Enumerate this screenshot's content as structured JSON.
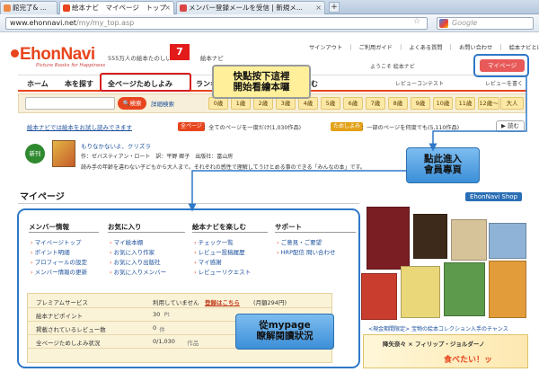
{
  "browser": {
    "tabs": [
      {
        "label": "館完了& ..."
      },
      {
        "label": "絵本ナビ　マイページ　トップ"
      },
      {
        "label": "メンバー登録メールを受信 | 新規メ..."
      }
    ],
    "url_host": "www.ehonnavi.net",
    "url_path": "/my/my_top.asp",
    "search_placeholder": "Google"
  },
  "site": {
    "logo": "EhonNavi",
    "logo_sub": "Picture Books for Happiness",
    "tagline": "555万人の絵本たのしい",
    "tagline_suffix": "絵本ナビ",
    "toplinks": "サインアウト　｜　ご利用ガイド　｜　よくある質問　｜　お問い合わせ　｜　絵本ナビとは",
    "welcome": "ようこそ 絵本ナビ",
    "mypage_button": "マイページ"
  },
  "nav": {
    "home": "ホーム",
    "find": "本を探す",
    "fullpage": "全ページためしよみ",
    "more1": "ランキ",
    "more2": "しむ",
    "review_contest": "レビューコンテスト",
    "review_link": "レビューを書く"
  },
  "search": {
    "button": "検索",
    "advanced": "詳細検索",
    "ages": [
      "0歳",
      "1歳",
      "2歳",
      "3歳",
      "4歳",
      "5歳",
      "6歳",
      "7歳",
      "8歳",
      "9歳",
      "10歳",
      "11歳",
      "12歳～",
      "大人"
    ]
  },
  "info": {
    "link": "絵本ナビでは絵本をお試し読みできます",
    "badge1": "全ページ",
    "text1": "：全てのページを一度だけ(1,030作品)",
    "badge2": "ためしよみ",
    "text2": "：一部のページを何度でも(5,110作品)",
    "read_button": "読む"
  },
  "new_book": {
    "badge": "新刊",
    "title": "もりなかないよ、クリズラ",
    "meta": "作：ゼバスティアン・ロート　訳：平野 卿子　出版社：冨山房",
    "desc": "読み手の年齢を違わない子どもから大人まで。それぞれの感性で理解してうけとめる事のできる「みんなの本」です。"
  },
  "mypage": {
    "title": "マイページ",
    "shop": "EhonNavi Shop",
    "columns": [
      {
        "heading": "メンバー情報",
        "links": [
          "マイページトップ",
          "ポイント明細",
          "プロフィールの設定",
          "メンバー情報の更新"
        ]
      },
      {
        "heading": "お気に入り",
        "links": [
          "マイ絵本棚",
          "お気に入り作家",
          "お気に入り出版社",
          "お気に入りメンバー"
        ]
      },
      {
        "heading": "絵本ナビを楽しむ",
        "links": [
          "チェック一覧",
          "レビュー投稿履歴",
          "マイ感謝",
          "レビューリクエスト"
        ]
      },
      {
        "heading": "サポート",
        "links": [
          "ご意見・ご要望",
          "HRP配信 問い合わせ"
        ]
      }
    ],
    "stats": [
      {
        "label": "プレミアムサービス",
        "value": "利用していません",
        "link": "登録はこちら",
        "note": "(月額294円)"
      },
      {
        "label": "絵本ナビポイント",
        "value": "30",
        "unit": "Pt"
      },
      {
        "label": "掲載されているレビュー数",
        "value": "0",
        "unit": "件"
      },
      {
        "label": "全ページためしよみ状況",
        "value": "0/1,030",
        "unit": "作品"
      }
    ],
    "promo": "<現金期間限定> 宝物の絵本コレクション入手のチャンス",
    "banner_title": "降矢奈々 × フィリップ・ジョルダーノ",
    "banner_sub": "食べたい！ッ"
  },
  "annotations": {
    "step": "7",
    "a1_line1": "快點按下這裡",
    "a1_line2": "開始看繪本囉",
    "a2_line1": "點此進入",
    "a2_line2": "會員專頁",
    "a3_line1": "從mypage",
    "a3_line2": "瞭解閱讀狀況"
  }
}
